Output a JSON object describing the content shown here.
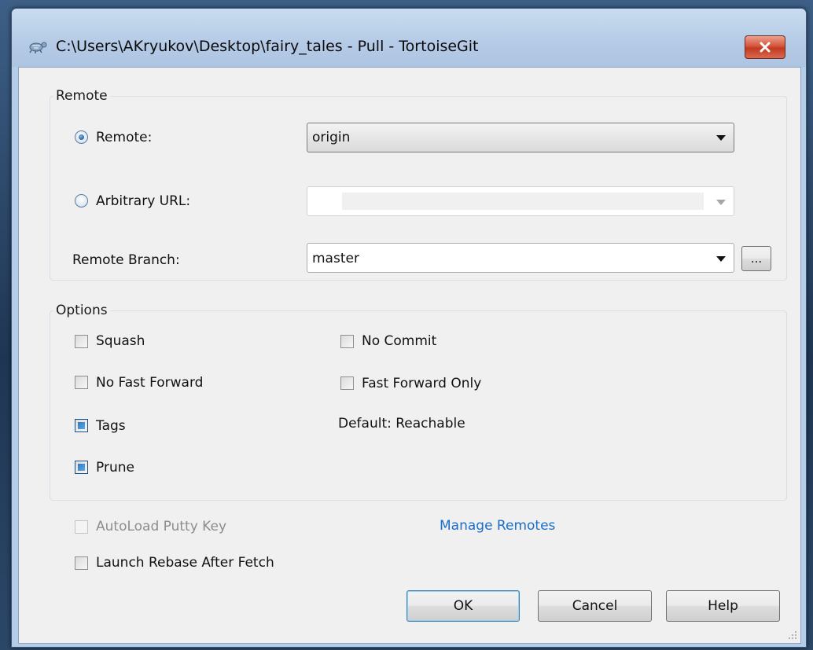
{
  "window": {
    "title": "C:\\Users\\AKryukov\\Desktop\\fairy_tales - Pull - TortoiseGit",
    "close_icon": "close-icon"
  },
  "remote_group": {
    "label": "Remote",
    "remote_radio": {
      "label": "Remote:",
      "selected": true
    },
    "remote_combo": {
      "value": "origin"
    },
    "url_radio": {
      "label": "Arbitrary URL:",
      "selected": false
    },
    "url_combo": {
      "value": ""
    },
    "branch": {
      "label": "Remote Branch:",
      "value": "master",
      "browse_label": "..."
    }
  },
  "options_group": {
    "label": "Options",
    "squash": {
      "label": "Squash",
      "checked": false
    },
    "no_commit": {
      "label": "No Commit",
      "checked": false
    },
    "no_fast_forward": {
      "label": "No Fast Forward",
      "checked": false
    },
    "fast_forward_only": {
      "label": "Fast Forward Only",
      "checked": false
    },
    "tags": {
      "label": "Tags",
      "checked": true
    },
    "tags_default": "Default: Reachable",
    "prune": {
      "label": "Prune",
      "checked": true
    }
  },
  "autoload_putty_key": {
    "label": "AutoLoad Putty Key",
    "checked": false,
    "enabled": false
  },
  "manage_remotes_link": "Manage Remotes",
  "launch_rebase": {
    "label": "Launch Rebase After Fetch",
    "checked": false
  },
  "buttons": {
    "ok": "OK",
    "cancel": "Cancel",
    "help": "Help"
  },
  "colors": {
    "accent": "#1a6fc8",
    "titlebar": "#b6cde8",
    "close": "#c23a20",
    "checkbox_fill": "#2d7ac1"
  }
}
